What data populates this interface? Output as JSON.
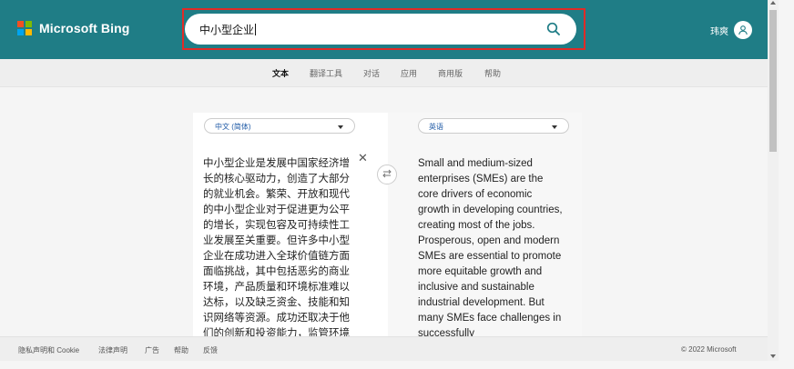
{
  "brand": {
    "name": "Microsoft Bing",
    "logo_colors": [
      "#f25022",
      "#7fba00",
      "#00a4ef",
      "#ffb900"
    ]
  },
  "search": {
    "value": "中小型企业",
    "icon": "search-icon"
  },
  "user": {
    "name": "玮爽",
    "icon": "user-icon"
  },
  "nav": {
    "items": [
      {
        "label": "文本",
        "active": true
      },
      {
        "label": "翻译工具",
        "active": false
      },
      {
        "label": "对话",
        "active": false
      },
      {
        "label": "应用",
        "active": false
      },
      {
        "label": "商用版",
        "active": false
      },
      {
        "label": "帮助",
        "active": false
      }
    ]
  },
  "translator": {
    "source_lang": "中文 (简体)",
    "target_lang": "英语",
    "source_text": "中小型企业是发展中国家经济增长的核心驱动力，创造了大部分的就业机会。繁荣、开放和现代的中小型企业对于促进更为公平的增长，实现包容及可持续性工业发展至关重要。但许多中小型企业在成功进入全球价值链方面面临挑战，其中包括恶劣的商业环境，产品质量和环境标准难以达标，以及缺乏资金、技能和知识网络等资源。成功还取决于他们的创新和投资能力，监管环境下",
    "target_text": "Small and medium-sized enterprises (SMEs) are the core drivers of economic growth in developing countries, creating most of the jobs. Prosperous, open and modern SMEs are essential to promote more equitable growth and inclusive and sustainable industrial development. But many SMEs face challenges in successfully",
    "clear_icon": "close-icon",
    "swap_icon": "swap-icon"
  },
  "footer": {
    "links": [
      "隐私声明和 Cookie",
      "法律声明",
      "广告",
      "帮助",
      "反馈"
    ],
    "copyright": "© 2022 Microsoft"
  },
  "colors": {
    "header": "#1f7d86",
    "highlight": "#e02b27",
    "lang_text": "#1f5aa6"
  }
}
